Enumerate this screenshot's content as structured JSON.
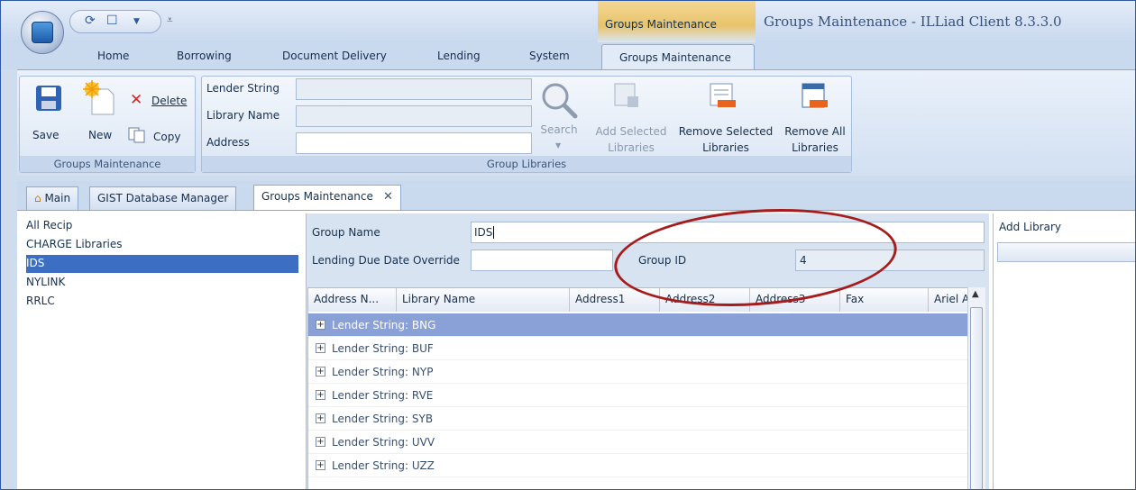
{
  "window": {
    "title": "Groups Maintenance - ILLiad Client 8.3.3.0",
    "context_tab_title": "Groups Maintenance"
  },
  "ribbon_tabs": [
    "Home",
    "Borrowing",
    "Document Delivery",
    "Lending",
    "System",
    "Groups Maintenance"
  ],
  "ribbon": {
    "groups_maintenance": {
      "save": "Save",
      "new": "New",
      "delete": "Delete",
      "copy": "Copy",
      "caption": "Groups Maintenance"
    },
    "group_libraries": {
      "lender_string_label": "Lender String",
      "library_name_label": "Library Name",
      "address_label": "Address",
      "search": "Search",
      "add_selected": [
        "Add Selected",
        "Libraries"
      ],
      "remove_selected": [
        "Remove Selected",
        "Libraries"
      ],
      "remove_all": [
        "Remove All",
        "Libraries"
      ],
      "caption": "Group Libraries"
    }
  },
  "doc_tabs": [
    "Main",
    "GIST Database Manager",
    "Groups Maintenance"
  ],
  "groups": [
    "All Recip",
    "CHARGE Libraries",
    "IDS",
    "NYLINK",
    "RRLC"
  ],
  "selected_group": "IDS",
  "form": {
    "group_name_label": "Group Name",
    "group_name_value": "IDS",
    "due_date_label": "Lending Due Date Override",
    "due_date_value": "",
    "group_id_label": "Group ID",
    "group_id_value": "4"
  },
  "grid": {
    "columns": [
      "Address N...",
      "Library Name",
      "Address1",
      "Address2",
      "Address3",
      "Fax",
      "Ariel A"
    ],
    "rows": [
      "Lender String: BNG",
      "Lender String: BUF",
      "Lender String: NYP",
      "Lender String: RVE",
      "Lender String: SYB",
      "Lender String: UVV",
      "Lender String: UZZ"
    ]
  },
  "add_library": {
    "title": "Add Library"
  },
  "colors": {
    "accent": "#3c6fc4",
    "highlight": "#a51c1c"
  }
}
